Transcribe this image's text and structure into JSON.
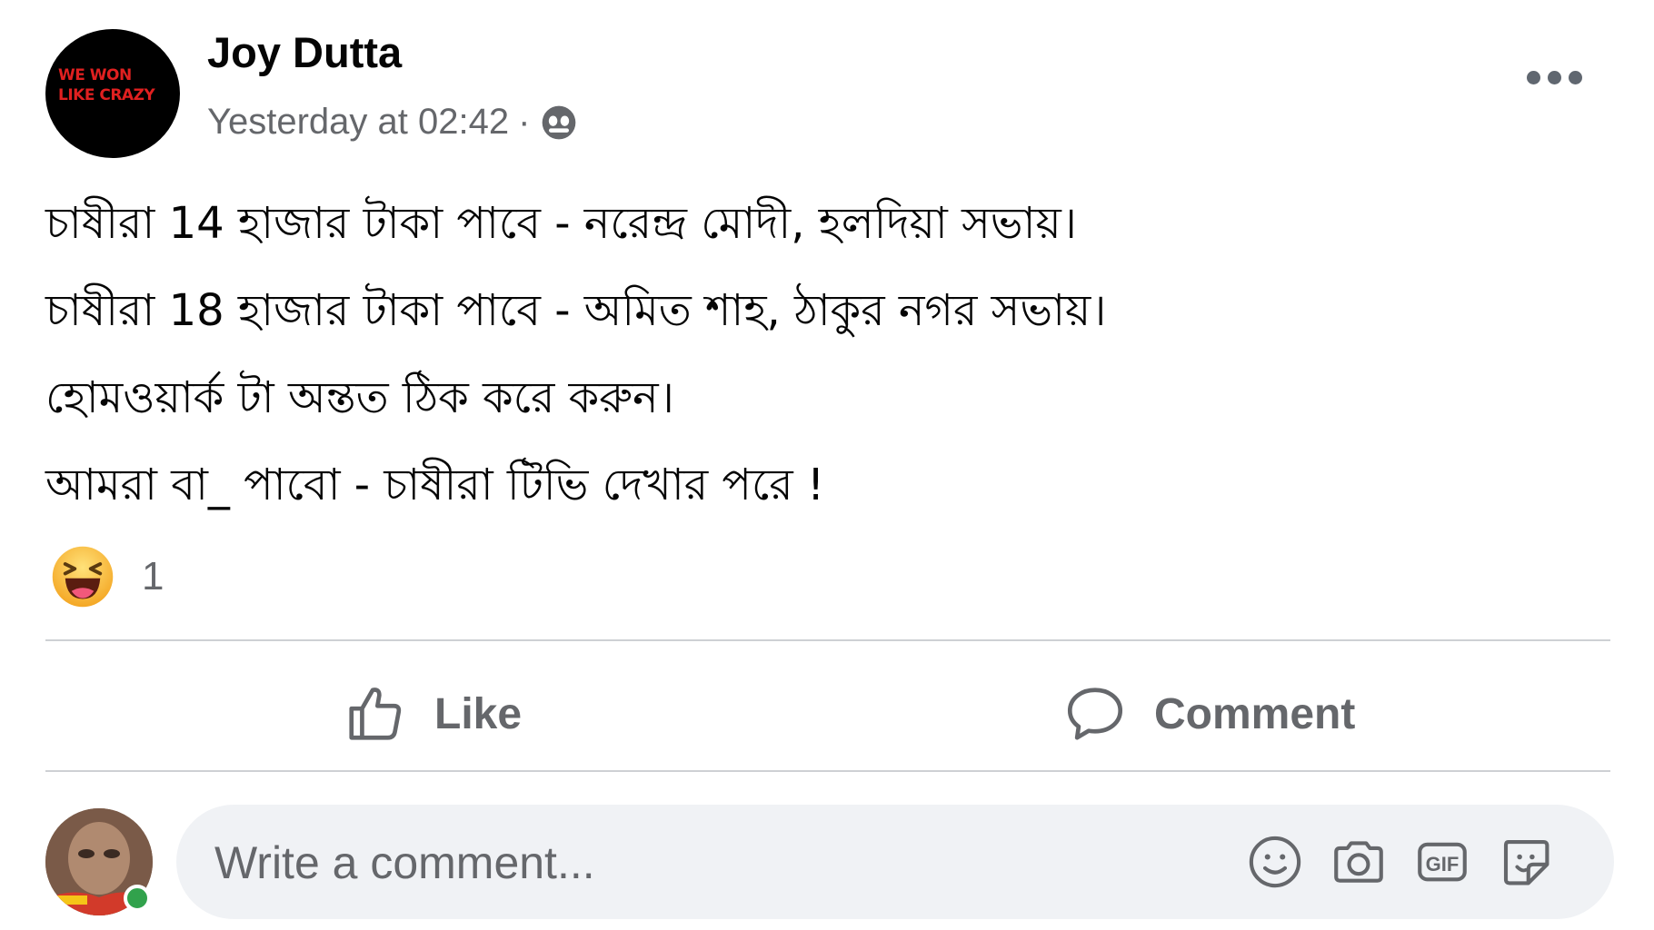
{
  "post": {
    "author": "Joy Dutta",
    "timestamp": "Yesterday at 02:42",
    "separator": "·",
    "privacy_icon": "globe-icon",
    "avatar_text": [
      "WE WON",
      "LIKE CRAZY"
    ],
    "lines": [
      "চাষীরা 14 হাজার টাকা পাবে - নরেন্দ্র মোদী, হলদিয়া সভায়।",
      "চাষীরা 18 হাজার টাকা পাবে - অমিত শাহ, ঠাকুর নগর সভায়।",
      "হোমওয়ার্ক টা অন্তত ঠিক করে করুন।",
      "আমরা বা_ পাবো - চাষীরা টিভি দেখার পরে !"
    ]
  },
  "reactions": {
    "icon": "haha-reaction-icon",
    "count": "1"
  },
  "actions": {
    "like_label": "Like",
    "comment_label": "Comment"
  },
  "comment_box": {
    "placeholder": "Write a comment...",
    "tools": [
      "emoji-icon",
      "camera-icon",
      "gif-icon",
      "sticker-icon"
    ]
  },
  "colors": {
    "secondary_text": "#65676b",
    "divider": "#ced0d4",
    "input_bg": "#f0f2f5",
    "online": "#31a24c"
  }
}
